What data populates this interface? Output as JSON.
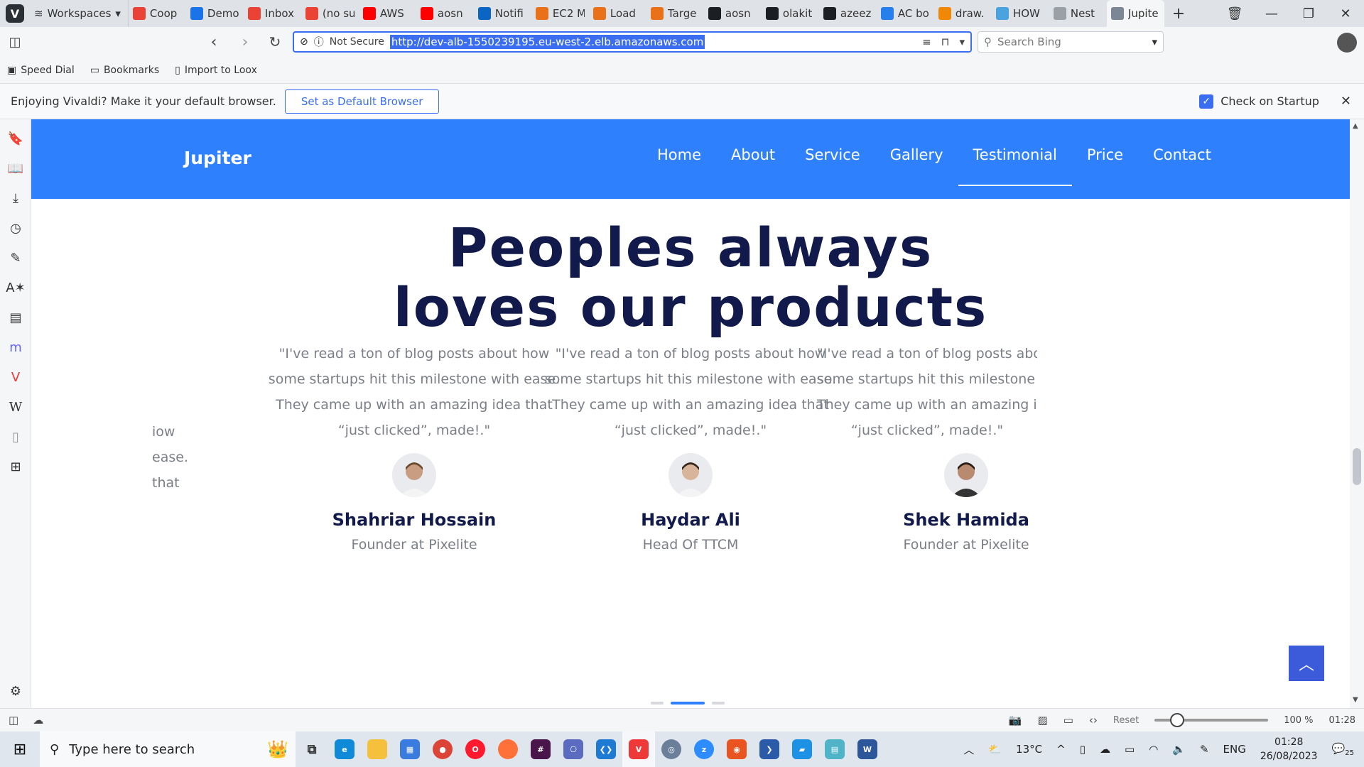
{
  "browser": {
    "workspaces_label": "Workspaces",
    "tabs": [
      {
        "title": "Coop",
        "icon": "gmail-icon",
        "color": "#ea4335"
      },
      {
        "title": "Demo",
        "icon": "info-icon",
        "color": "#1a73e8"
      },
      {
        "title": "Inbox",
        "icon": "gmail-icon",
        "color": "#ea4335"
      },
      {
        "title": "(no su",
        "icon": "gmail-icon",
        "color": "#ea4335"
      },
      {
        "title": "AWS",
        "icon": "youtube-icon",
        "color": "#ff0000"
      },
      {
        "title": "aosn",
        "icon": "youtube-icon",
        "color": "#ff0000"
      },
      {
        "title": "Notifi",
        "icon": "linkedin-icon",
        "color": "#0a66c2"
      },
      {
        "title": "EC2 M",
        "icon": "aws-icon",
        "color": "#e8711a"
      },
      {
        "title": "Load",
        "icon": "aws-icon",
        "color": "#e8711a"
      },
      {
        "title": "Targe",
        "icon": "aws-icon",
        "color": "#e8711a"
      },
      {
        "title": "aosn",
        "icon": "github-icon",
        "color": "#1b1f23"
      },
      {
        "title": "olakit",
        "icon": "github-icon",
        "color": "#1b1f23"
      },
      {
        "title": "azeez",
        "icon": "github-icon",
        "color": "#1b1f23"
      },
      {
        "title": "AC bo",
        "icon": "diamond-icon",
        "color": "#2680eb"
      },
      {
        "title": "draw.",
        "icon": "drawio-icon",
        "color": "#f08705"
      },
      {
        "title": "HOW",
        "icon": "how-icon",
        "color": "#4aa3df"
      },
      {
        "title": "Nest",
        "icon": "page-icon",
        "color": "#9aa0a6"
      },
      {
        "title": "Jupite",
        "icon": "jupiter-icon",
        "color": "#7b8794",
        "active": true
      }
    ],
    "address": {
      "security": "Not Secure",
      "url": "http://dev-alb-1550239195.eu-west-2.elb.amazonaws.com"
    },
    "search_placeholder": "Search Bing",
    "bookmarks": [
      "Speed Dial",
      "Bookmarks",
      "Import to Loox"
    ],
    "notification": {
      "message": "Enjoying Vivaldi? Make it your default browser.",
      "button": "Set as Default Browser",
      "checkbox_label": "Check on Startup"
    },
    "status": {
      "reset_label": "Reset",
      "zoom": "100 %",
      "time": "01:28"
    }
  },
  "site": {
    "brand": "Jupiter",
    "nav": [
      "Home",
      "About",
      "Service",
      "Gallery",
      "Testimonial",
      "Price",
      "Contact"
    ],
    "active_nav": "Testimonial",
    "heading_line1": "Peoples always",
    "heading_line2": "loves our products",
    "testimonials": [
      {
        "quote": "\"I've read a ton of blog posts about how\nsome startups hit this milestone with ease.\nThey came up with an amazing idea that\n“just clicked”, made!.\"",
        "name": "Shahriar Hossain",
        "role": "Founder at Pixelite"
      },
      {
        "quote": "\"I've read a ton of blog posts about how\nsome startups hit this milestone with ease.\nThey came up with an amazing idea that\n“just clicked”, made!.\"",
        "name": "Haydar Ali",
        "role": "Head Of TTCM"
      },
      {
        "quote": "\"I've read a ton of blog posts about h\nsome startups hit this milestone with\nThey came up with an amazing idea t\n“just clicked”, made!.\"",
        "name": "Shek Hamida",
        "role": "Founder at Pixelite"
      }
    ],
    "partial_quote_left": "iow\nease.\nthat"
  },
  "taskbar": {
    "search_placeholder": "Type here to search",
    "weather": "13°C",
    "language": "ENG",
    "time": "01:28",
    "date": "26/08/2023",
    "notifications_count": "25"
  },
  "colors": {
    "accent": "#2f80fc",
    "heading": "#111a4a",
    "vivaldi": "#3b6df0"
  }
}
